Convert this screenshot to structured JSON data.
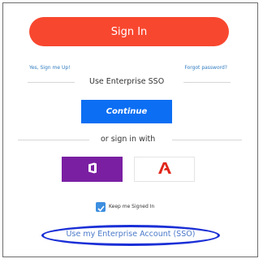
{
  "signin": {
    "label": "Sign In"
  },
  "links": {
    "signup": "Yes, Sign me Up!",
    "forgot": "Forgot password?"
  },
  "sso_divider": "Use Enterprise SSO",
  "continue": "Continue",
  "social_divider": "or sign in with",
  "social": [
    {
      "icon": "office-icon",
      "bg": "#7a1fa2"
    },
    {
      "icon": "adobe-icon",
      "color": "#e0261a"
    }
  ],
  "keep_signed_in": {
    "label": "Keep me Signed In",
    "checked": true
  },
  "enterprise_link": "Use my Enterprise Account (SSO)",
  "colors": {
    "primary": "#f8472f",
    "continue": "#0b6ef3",
    "link": "#2f7bbf",
    "highlight": "#1a2fd6"
  }
}
